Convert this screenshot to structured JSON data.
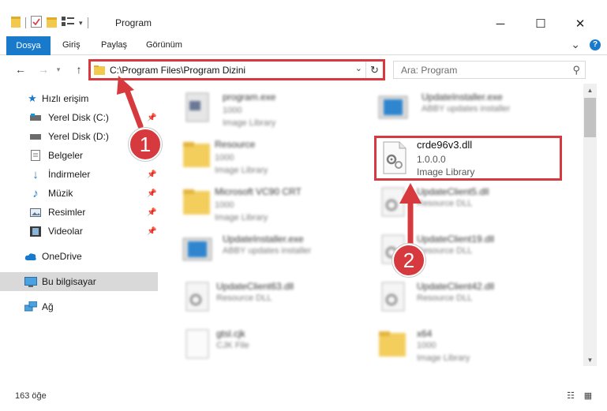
{
  "window": {
    "title": "Program",
    "minimize_icon": "─",
    "maximize_icon": "☐",
    "close_icon": "✕"
  },
  "ribbon": {
    "tabs": [
      "Dosya",
      "Giriş",
      "Paylaş",
      "Görünüm"
    ],
    "help_icon": "?",
    "expand_icon": "⌄"
  },
  "address_bar": {
    "path": "C:\\Program Files\\Program Dizini",
    "search_placeholder": "Ara: Program"
  },
  "sidebar": {
    "items": [
      {
        "label": "Hızlı erişim",
        "icon": "star-icon",
        "pinned": false
      },
      {
        "label": "Yerel Disk (C:)",
        "icon": "drive-icon",
        "pinned": true
      },
      {
        "label": "Yerel Disk (D:)",
        "icon": "drive-icon",
        "pinned": false
      },
      {
        "label": "Belgeler",
        "icon": "documents-icon",
        "pinned": true
      },
      {
        "label": "İndirmeler",
        "icon": "download-icon",
        "pinned": true
      },
      {
        "label": "Müzik",
        "icon": "music-icon",
        "pinned": true
      },
      {
        "label": "Resimler",
        "icon": "pictures-icon",
        "pinned": true
      },
      {
        "label": "Videolar",
        "icon": "video-icon",
        "pinned": true
      },
      {
        "label": "OneDrive",
        "icon": "cloud-icon",
        "pinned": false
      },
      {
        "label": "Bu bilgisayar",
        "icon": "computer-icon",
        "pinned": false,
        "selected": true
      },
      {
        "label": "Ağ",
        "icon": "network-icon",
        "pinned": false
      }
    ]
  },
  "files": [
    {
      "name": "program.exe",
      "line1": "1000",
      "line2": "Image Library",
      "icon": "exe-icon"
    },
    {
      "name": "UpdateInstaller.exe",
      "line1": "ABBY updates installer",
      "line2": "",
      "icon": "installer-icon"
    },
    {
      "name": "Resource",
      "line1": "1000",
      "line2": "Image Library",
      "icon": "folder-icon"
    },
    {
      "name": "crde96v3.dll",
      "line1": "1.0.0.0",
      "line2": "Image Library",
      "icon": "dll-icon",
      "highlighted": true
    },
    {
      "name": "Microsoft VC90 CRT",
      "line1": "1000",
      "line2": "Image Library",
      "icon": "folder-icon"
    },
    {
      "name": "UpdateClient5.dll",
      "line1": "Resource DLL",
      "line2": "",
      "icon": "dll-icon"
    },
    {
      "name": "UpdateInstaller.exe",
      "line1": "ABBY updates installer",
      "line2": "",
      "icon": "installer-icon"
    },
    {
      "name": "UpdateClient19.dll",
      "line1": "Resource DLL",
      "line2": "",
      "icon": "dll-icon"
    },
    {
      "name": "UpdateClient63.dll",
      "line1": "Resource DLL",
      "line2": "",
      "icon": "dll-icon"
    },
    {
      "name": "UpdateClient42.dll",
      "line1": "Resource DLL",
      "line2": "",
      "icon": "dll-icon"
    },
    {
      "name": "gtsl.cjk",
      "line1": "CJK File",
      "line2": "",
      "icon": "file-icon"
    },
    {
      "name": "x64",
      "line1": "1000",
      "line2": "Image Library",
      "icon": "folder-icon"
    }
  ],
  "status": {
    "item_count": "163 öğe"
  },
  "annotations": {
    "step1": "1",
    "step2": "2",
    "color": "#d6393e"
  }
}
